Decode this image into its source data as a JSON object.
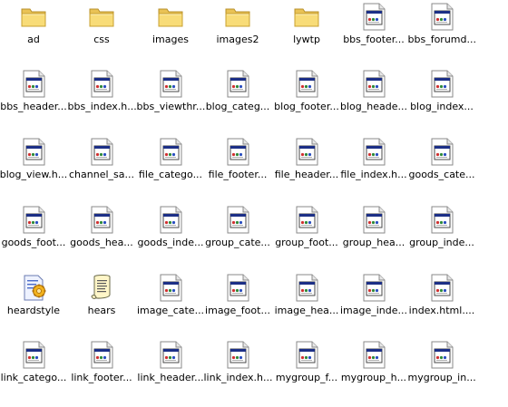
{
  "icon_kinds": {
    "folder": "folder-icon",
    "html": "html-file-icon",
    "css": "css-file-icon",
    "text": "text-file-icon"
  },
  "colors": {
    "folder_fill": "#f6d870",
    "folder_edge": "#c8a030",
    "page_fill": "#ffffff",
    "page_edge": "#808080",
    "titlebar": "#1c2f86"
  },
  "rows": [
    [
      {
        "label": "ad",
        "kind": "folder"
      },
      {
        "label": "css",
        "kind": "folder"
      },
      {
        "label": "images",
        "kind": "folder"
      },
      {
        "label": "images2",
        "kind": "folder"
      },
      {
        "label": "lywtp",
        "kind": "folder"
      },
      {
        "label": "bbs_footer...",
        "kind": "html"
      },
      {
        "label": "bbs_forumd...",
        "kind": "html"
      }
    ],
    [
      {
        "label": "bbs_header...",
        "kind": "html"
      },
      {
        "label": "bbs_index.h...",
        "kind": "html"
      },
      {
        "label": "bbs_viewthr...",
        "kind": "html"
      },
      {
        "label": "blog_categ...",
        "kind": "html"
      },
      {
        "label": "blog_footer...",
        "kind": "html"
      },
      {
        "label": "blog_heade...",
        "kind": "html"
      },
      {
        "label": "blog_index...",
        "kind": "html"
      }
    ],
    [
      {
        "label": "blog_view.h...",
        "kind": "html"
      },
      {
        "label": "channel_sa...",
        "kind": "html"
      },
      {
        "label": "file_catego...",
        "kind": "html"
      },
      {
        "label": "file_footer...",
        "kind": "html"
      },
      {
        "label": "file_header...",
        "kind": "html"
      },
      {
        "label": "file_index.h...",
        "kind": "html"
      },
      {
        "label": "goods_cate...",
        "kind": "html"
      }
    ],
    [
      {
        "label": "goods_foot...",
        "kind": "html"
      },
      {
        "label": "goods_hea...",
        "kind": "html"
      },
      {
        "label": "goods_inde...",
        "kind": "html"
      },
      {
        "label": "group_cate...",
        "kind": "html"
      },
      {
        "label": "group_foot...",
        "kind": "html"
      },
      {
        "label": "group_hea...",
        "kind": "html"
      },
      {
        "label": "group_inde...",
        "kind": "html"
      }
    ],
    [
      {
        "label": "heardstyle",
        "kind": "css"
      },
      {
        "label": "hears",
        "kind": "text"
      },
      {
        "label": "image_cate...",
        "kind": "html"
      },
      {
        "label": "image_foot...",
        "kind": "html"
      },
      {
        "label": "image_hea...",
        "kind": "html"
      },
      {
        "label": "image_inde...",
        "kind": "html"
      },
      {
        "label": "index.html....",
        "kind": "html"
      }
    ],
    [
      {
        "label": "link_catego...",
        "kind": "html"
      },
      {
        "label": "link_footer...",
        "kind": "html"
      },
      {
        "label": "link_header...",
        "kind": "html"
      },
      {
        "label": "link_index.h...",
        "kind": "html"
      },
      {
        "label": "mygroup_f...",
        "kind": "html"
      },
      {
        "label": "mygroup_h...",
        "kind": "html"
      },
      {
        "label": "mygroup_in...",
        "kind": "html"
      }
    ]
  ]
}
